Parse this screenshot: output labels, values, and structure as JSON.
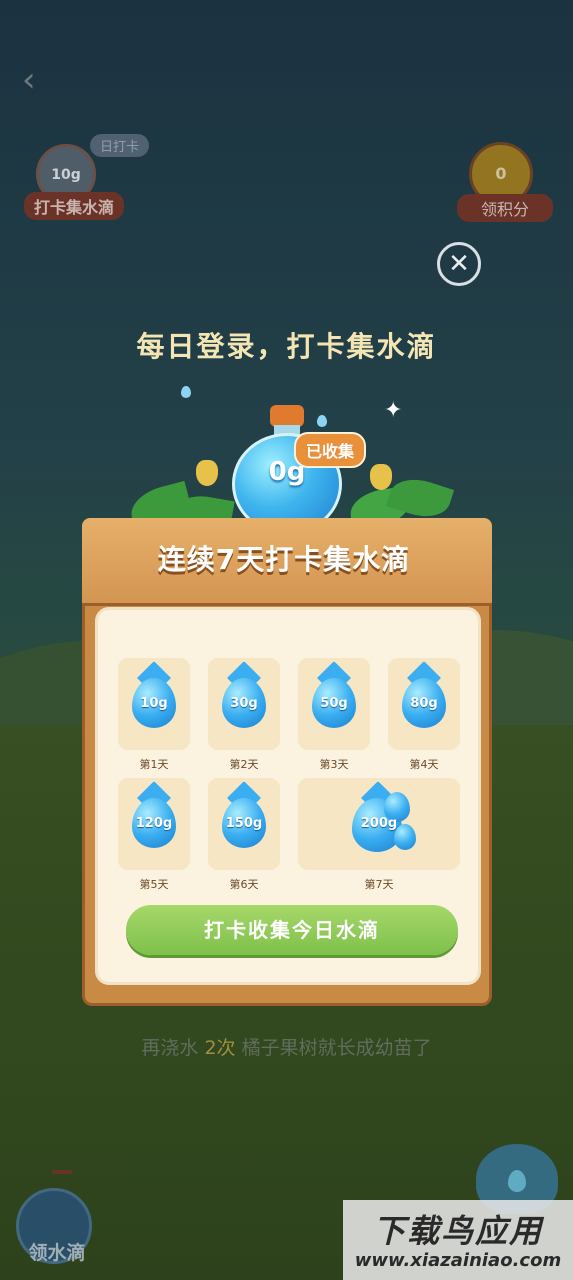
{
  "background_top_left": {
    "bottle_value": "10g",
    "tag": "日打卡",
    "label": "打卡集水滴"
  },
  "background_top_right": {
    "coin_value": "0",
    "label": "领积分"
  },
  "modal": {
    "headline": "每日登录，打卡集水滴",
    "bottle_value": "0g",
    "collected_tag": "已收集",
    "board_title": "连续7天打卡集水滴",
    "days": [
      {
        "amount": "10g",
        "label": "第1天"
      },
      {
        "amount": "30g",
        "label": "第2天"
      },
      {
        "amount": "50g",
        "label": "第3天"
      },
      {
        "amount": "80g",
        "label": "第4天"
      },
      {
        "amount": "120g",
        "label": "第5天"
      },
      {
        "amount": "150g",
        "label": "第6天"
      },
      {
        "amount": "200g",
        "label": "第7天"
      }
    ],
    "cta_label": "打卡收集今日水滴"
  },
  "background_subnote": {
    "prefix": "再浇水",
    "highlight": "2次",
    "suffix": "橘子果树就长成幼苗了"
  },
  "bottom_left": {
    "label": "领水滴"
  },
  "watermark": {
    "title": "下载鸟应用",
    "url": "www.xiazainiao.com"
  },
  "colors": {
    "accent_orange": "#e8903a",
    "cta_green": "#7ec04a",
    "board_wood": "#c98a45",
    "headline_text": "#f4e6b4"
  }
}
